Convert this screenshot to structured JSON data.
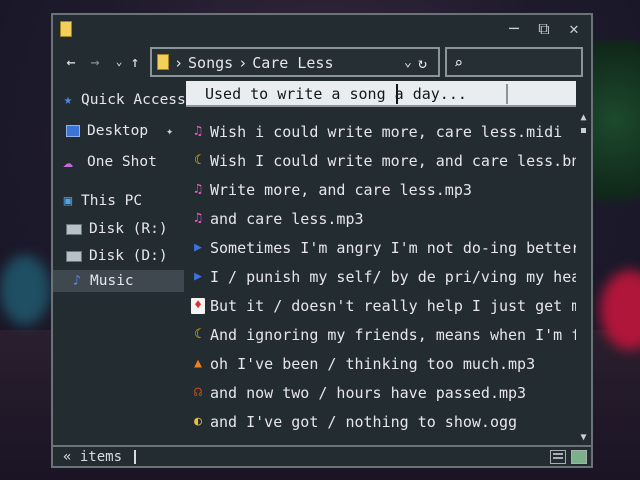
{
  "window": {
    "controls": {
      "minimize": "─",
      "restore": "⧉",
      "close": "✕"
    }
  },
  "toolbar": {
    "back": "←",
    "forward": "→",
    "recent": "⌄",
    "up": "↑",
    "breadcrumb": [
      "›",
      "Songs",
      "›",
      "Care Less"
    ],
    "address_chevron": "⌄",
    "refresh": "↻",
    "search": {
      "icon": "⌕",
      "placeholder": ""
    }
  },
  "sidebar": {
    "items": [
      {
        "label": "Quick Access",
        "icon": "star-icon",
        "glyph": "★",
        "pinned": false
      },
      {
        "label": "Desktop",
        "icon": "desktop-icon",
        "glyph": "",
        "pinned": true
      },
      {
        "label": "One Shot",
        "icon": "cloud-icon",
        "glyph": "☁",
        "pinned": false
      },
      {
        "label": "This PC",
        "icon": "computer-icon",
        "glyph": "▣",
        "pinned": false
      },
      {
        "label": "Disk (R:)",
        "icon": "disk-icon",
        "glyph": "",
        "pinned": false
      },
      {
        "label": "Disk (D:)",
        "icon": "disk-icon",
        "glyph": "",
        "pinned": false
      },
      {
        "label": "Music",
        "icon": "music-note-icon",
        "glyph": "♪",
        "pinned": false,
        "selected": true
      }
    ],
    "pin_glyph": "✦"
  },
  "tooltip": {
    "text": "Used to write a song a day..."
  },
  "files": [
    {
      "name": "Wish i could write more, care less.midi",
      "glyph": "♫"
    },
    {
      "name": "Wish I could write more, and care less.bnn",
      "glyph": "☾"
    },
    {
      "name": "Write more, and care less.mp3",
      "glyph": "♫"
    },
    {
      "name": "and care less.mp3",
      "glyph": "♫"
    },
    {
      "name": "Sometimes I'm angry I'm not do-ing better thar",
      "glyph": "▶"
    },
    {
      "name": "I / punish my self/ by de pri/ving my health/",
      "glyph": "▶"
    },
    {
      "name": "But it / doesn't really help I just get more de",
      "glyph": "♦"
    },
    {
      "name": "And ignoring my friends, means when I'm finally",
      "glyph": "☾"
    },
    {
      "name": "oh I've been / thinking too much.mp3",
      "glyph": "▲"
    },
    {
      "name": "and now two / hours have passed.mp3",
      "glyph": "☊"
    },
    {
      "name": "and I've got / nothing to show.ogg",
      "glyph": "◐"
    }
  ],
  "scrollbar": {
    "up": "▲",
    "down": "▼"
  },
  "status": {
    "text": "« items"
  }
}
